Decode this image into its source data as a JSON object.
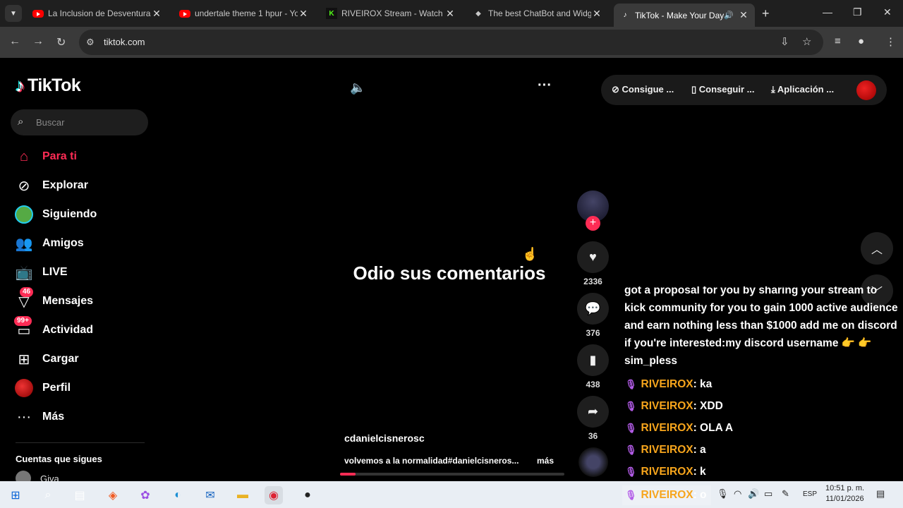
{
  "browser": {
    "tabs": [
      {
        "title": "La Inclusion de Desventura (",
        "favicon": "youtube-icon"
      },
      {
        "title": "undertale theme 1 hpur - Yo",
        "favicon": "youtube-icon"
      },
      {
        "title": "RIVEIROX Stream - Watch Li",
        "favicon": "kick-icon"
      },
      {
        "title": "The best ChatBot and Widg",
        "favicon": "botrix-icon"
      },
      {
        "title": "TikTok - Make Your Day",
        "favicon": "tiktok-icon",
        "active": true
      }
    ],
    "url": "tiktok.com"
  },
  "tiktok": {
    "brand": "TikTok",
    "search_placeholder": "Buscar",
    "nav": [
      {
        "label": "Para ti",
        "icon": "home-icon",
        "selected": true
      },
      {
        "label": "Explorar",
        "icon": "compass-icon"
      },
      {
        "label": "Siguiendo",
        "icon": "following-avatar-icon"
      },
      {
        "label": "Amigos",
        "icon": "friends-icon"
      },
      {
        "label": "LIVE",
        "icon": "live-tv-icon"
      },
      {
        "label": "Mensajes",
        "icon": "messages-icon",
        "badge": "46"
      },
      {
        "label": "Actividad",
        "icon": "activity-icon",
        "badge": "99+"
      },
      {
        "label": "Cargar",
        "icon": "upload-icon"
      },
      {
        "label": "Perfil",
        "icon": "profile-avatar-icon"
      },
      {
        "label": "Más",
        "icon": "more-dots-icon"
      }
    ],
    "following_title": "Cuentas que sigues",
    "following": [
      {
        "name": "Giva"
      }
    ],
    "top_actions": [
      {
        "label": "Consigue ...",
        "icon": "coin-icon"
      },
      {
        "label": "Conseguir ...",
        "icon": "phone-icon"
      },
      {
        "label": "Aplicación ...",
        "icon": "download-icon"
      }
    ],
    "video": {
      "caption": "Odio sus comentarios",
      "author": "cdanielcisnerosc",
      "description": "volvemos a la normalidad#danielcisneros...",
      "more": "más",
      "progress": 0.07,
      "likes": "2336",
      "comments": "376",
      "saves": "438",
      "shares": "36"
    }
  },
  "chat_overlay": {
    "first_message": "got a proposal for you by sharing your stream to kick community for you to gain 1000 active audience and earn nothing less than $1000 add me on discord if you're interested:my discord username 👉 👉 sim_pless",
    "lines": [
      {
        "user": "RIVEIROX",
        "text": ": ka"
      },
      {
        "user": "RIVEIROX",
        "text": ": XDD"
      },
      {
        "user": "RIVEIROX",
        "text": ": OLA A"
      },
      {
        "user": "RIVEIROX",
        "text": ": a"
      },
      {
        "user": "RIVEIROX",
        "text": ": k"
      },
      {
        "user": "RIVEIROX",
        "text": ": o"
      }
    ]
  },
  "taskbar": {
    "language": "ESP",
    "time": "10:51 p. m.",
    "date": "11/01/2026"
  },
  "colors": {
    "tiktok_red": "#fe2c55",
    "chat_user": "#f7a51c",
    "chat_mic": "#b35ce8",
    "kick_green": "#53fc18"
  }
}
